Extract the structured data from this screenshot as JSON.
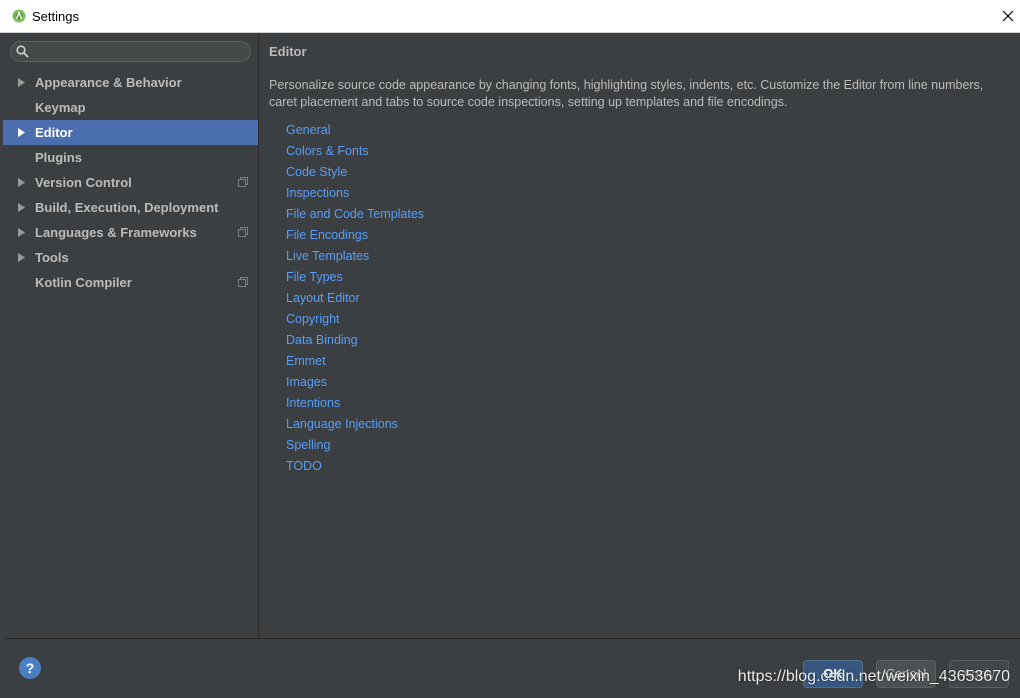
{
  "window": {
    "title": "Settings"
  },
  "search": {
    "placeholder": "",
    "value": ""
  },
  "sidebar": {
    "items": [
      {
        "label": "Appearance & Behavior",
        "has_arrow": true,
        "selected": false,
        "has_project_icon": false
      },
      {
        "label": "Keymap",
        "has_arrow": false,
        "selected": false,
        "has_project_icon": false
      },
      {
        "label": "Editor",
        "has_arrow": true,
        "selected": true,
        "has_project_icon": false
      },
      {
        "label": "Plugins",
        "has_arrow": false,
        "selected": false,
        "has_project_icon": false
      },
      {
        "label": "Version Control",
        "has_arrow": true,
        "selected": false,
        "has_project_icon": true
      },
      {
        "label": "Build, Execution, Deployment",
        "has_arrow": true,
        "selected": false,
        "has_project_icon": false
      },
      {
        "label": "Languages & Frameworks",
        "has_arrow": true,
        "selected": false,
        "has_project_icon": true
      },
      {
        "label": "Tools",
        "has_arrow": true,
        "selected": false,
        "has_project_icon": false
      },
      {
        "label": "Kotlin Compiler",
        "has_arrow": false,
        "selected": false,
        "has_project_icon": true
      }
    ]
  },
  "content": {
    "title": "Editor",
    "description": "Personalize source code appearance by changing fonts, highlighting styles, indents, etc. Customize the Editor from line numbers, caret placement and tabs to source code inspections, setting up templates and file encodings.",
    "links": [
      "General",
      "Colors & Fonts",
      "Code Style",
      "Inspections",
      "File and Code Templates",
      "File Encodings",
      "Live Templates",
      "File Types",
      "Layout Editor",
      "Copyright",
      "Data Binding",
      "Emmet",
      "Images",
      "Intentions",
      "Language Injections",
      "Spelling",
      "TODO"
    ]
  },
  "buttons": {
    "help": "?",
    "ok": "OK",
    "cancel": "Cancel",
    "apply": "Apply"
  },
  "watermark": "https://blog.csdn.net/weixin_43653670",
  "colors": {
    "background": "#3c3f41",
    "selection": "#4b6eaf",
    "link": "#589df6",
    "text": "#bbbbbb"
  }
}
